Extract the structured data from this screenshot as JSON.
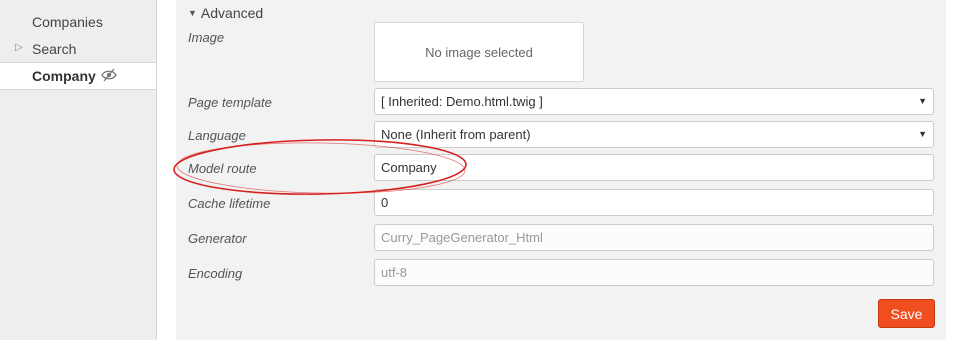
{
  "sidebar": {
    "items": [
      {
        "label": "Companies"
      },
      {
        "label": "Search"
      },
      {
        "label": "Company"
      }
    ]
  },
  "section": {
    "label": "Advanced"
  },
  "form": {
    "image": {
      "label": "Image",
      "empty_text": "No image selected"
    },
    "page_template": {
      "label": "Page template",
      "value": "[ Inherited: Demo.html.twig ]"
    },
    "language": {
      "label": "Language",
      "value": "None (Inherit from parent)"
    },
    "model_route": {
      "label": "Model route",
      "value": "Company"
    },
    "cache_lifetime": {
      "label": "Cache lifetime",
      "value": "0"
    },
    "generator": {
      "label": "Generator",
      "value": "Curry_PageGenerator_Html"
    },
    "encoding": {
      "label": "Encoding",
      "value": "utf-8"
    }
  },
  "save_button": {
    "label": "Save"
  },
  "colors": {
    "accent": "#f04e1e",
    "annotation": "#d62020",
    "sidebar_bg": "#eeeeee",
    "panel_bg": "#f2f2f2"
  },
  "icons": {
    "visibility": "eye-slash-icon",
    "expand": "triangle-right-icon",
    "collapse": "triangle-down-icon",
    "dropdown": "caret-down-icon"
  }
}
